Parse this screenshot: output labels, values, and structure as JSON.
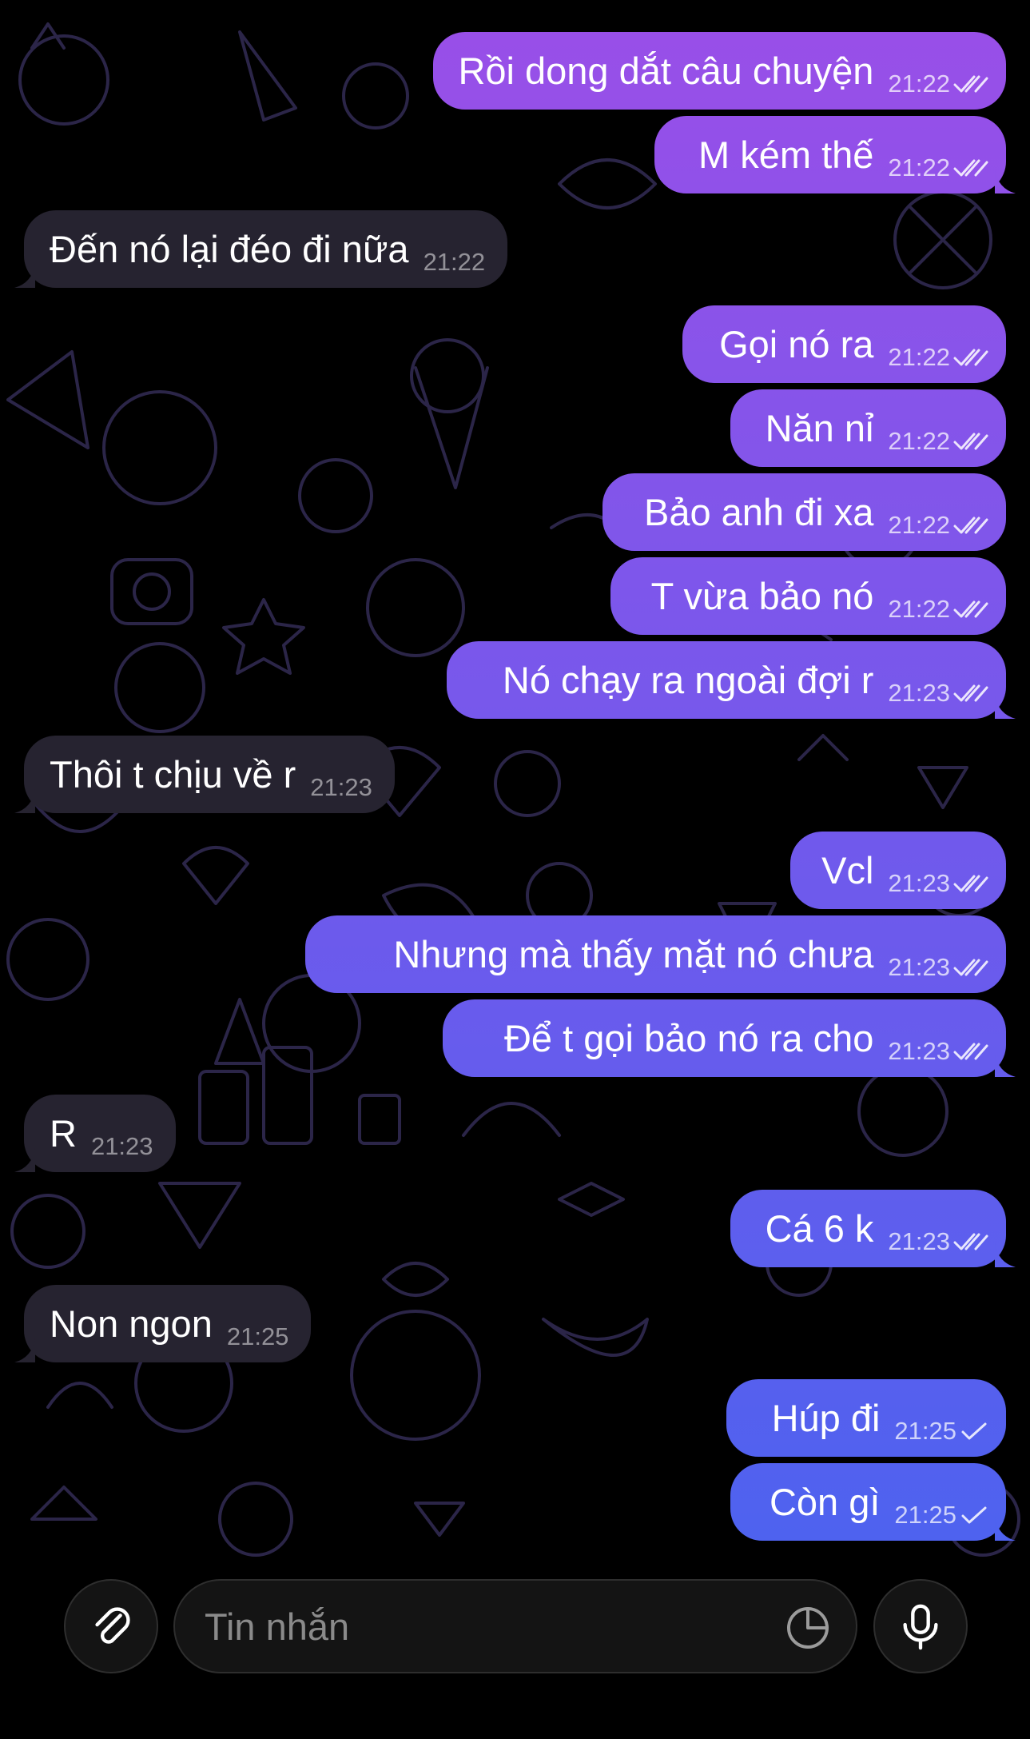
{
  "colors": {
    "background": "#000000",
    "incoming_bubble": "#262330",
    "outgoing_gradient": [
      "#9a4fe8",
      "#4e62ef"
    ],
    "doodle": "#2b2548"
  },
  "messages": [
    {
      "dir": "out",
      "text": "Rồi dong dắt câu chuyện",
      "time": "21:22",
      "status": "read",
      "tail": false
    },
    {
      "dir": "out",
      "text": "M kém thế",
      "time": "21:22",
      "status": "read",
      "tail": true
    },
    {
      "dir": "in",
      "text": "Đến nó lại đéo đi nữa",
      "time": "21:22",
      "tail": true
    },
    {
      "dir": "out",
      "text": "Gọi nó ra",
      "time": "21:22",
      "status": "read",
      "tail": false
    },
    {
      "dir": "out",
      "text": "Năn nỉ",
      "time": "21:22",
      "status": "read",
      "tail": false
    },
    {
      "dir": "out",
      "text": "Bảo anh đi xa",
      "time": "21:22",
      "status": "read",
      "tail": false
    },
    {
      "dir": "out",
      "text": "T vừa bảo nó",
      "time": "21:22",
      "status": "read",
      "tail": false
    },
    {
      "dir": "out",
      "text": "Nó chạy ra ngoài đợi r",
      "time": "21:23",
      "status": "read",
      "tail": true
    },
    {
      "dir": "in",
      "text": "Thôi t chịu về r",
      "time": "21:23",
      "tail": true
    },
    {
      "dir": "out",
      "text": "Vcl",
      "time": "21:23",
      "status": "read",
      "tail": false
    },
    {
      "dir": "out",
      "text": "Nhưng mà thấy mặt nó chưa",
      "time": "21:23",
      "status": "read",
      "tail": false
    },
    {
      "dir": "out",
      "text": "Để t gọi bảo nó ra cho",
      "time": "21:23",
      "status": "read",
      "tail": true
    },
    {
      "dir": "in",
      "text": "R",
      "time": "21:23",
      "tail": true
    },
    {
      "dir": "out",
      "text": "Cá 6 k",
      "time": "21:23",
      "status": "read",
      "tail": true
    },
    {
      "dir": "in",
      "text": "Non ngon",
      "time": "21:25",
      "tail": true
    },
    {
      "dir": "out",
      "text": "Húp đi",
      "time": "21:25",
      "status": "sent",
      "tail": false
    },
    {
      "dir": "out",
      "text": "Còn gì",
      "time": "21:25",
      "status": "sent",
      "tail": true
    }
  ],
  "composer": {
    "placeholder": "Tin nhắn",
    "attach_icon": "paperclip-icon",
    "sticker_icon": "sticker-icon",
    "mic_icon": "microphone-icon"
  }
}
